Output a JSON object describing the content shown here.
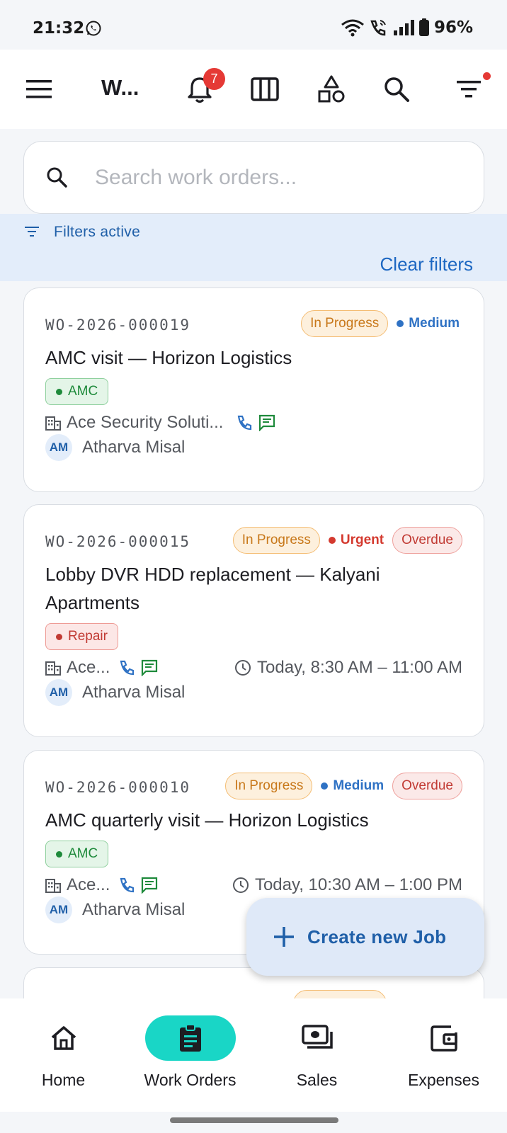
{
  "status_bar": {
    "time": "21:32",
    "battery": "96%"
  },
  "app_bar": {
    "title": "W...",
    "notification_count": "7"
  },
  "search": {
    "placeholder": "Search work orders..."
  },
  "filters": {
    "status": "Filters active",
    "clear_label": "Clear filters"
  },
  "work_orders": [
    {
      "id": "WO-2026-000019",
      "status": "In Progress",
      "priority": "Medium",
      "overdue": "",
      "title_lines": [
        "AMC visit — Horizon Logistics"
      ],
      "type": "AMC",
      "company": "Ace Security Soluti...",
      "time": "",
      "assignee_initials": "AM",
      "assignee": "Atharva Misal"
    },
    {
      "id": "WO-2026-000015",
      "status": "In Progress",
      "priority": "Urgent",
      "overdue": "Overdue",
      "title_lines": [
        "Lobby DVR HDD replacement — Kalyani",
        "Apartments"
      ],
      "type": "Repair",
      "company": "Ace...",
      "time": "Today, 8:30 AM – 11:00 AM",
      "assignee_initials": "AM",
      "assignee": "Atharva Misal"
    },
    {
      "id": "WO-2026-000010",
      "status": "In Progress",
      "priority": "Medium",
      "overdue": "Overdue",
      "title_lines": [
        "AMC quarterly visit — Horizon Logistics"
      ],
      "type": "AMC",
      "company": "Ace...",
      "time": "Today, 10:30 AM – 1:00 PM",
      "assignee_initials": "AM",
      "assignee": "Atharva Misal"
    }
  ],
  "fab": {
    "label": "Create new Job"
  },
  "bottom_nav": [
    {
      "label": "Home",
      "icon": "home-icon"
    },
    {
      "label": "Work Orders",
      "icon": "clipboard-icon",
      "active": true
    },
    {
      "label": "Sales",
      "icon": "sales-icon"
    },
    {
      "label": "Expenses",
      "icon": "wallet-icon"
    }
  ],
  "colors": {
    "accent": "#19d6c6",
    "link": "#1c67c2",
    "badge": "#e53935"
  }
}
